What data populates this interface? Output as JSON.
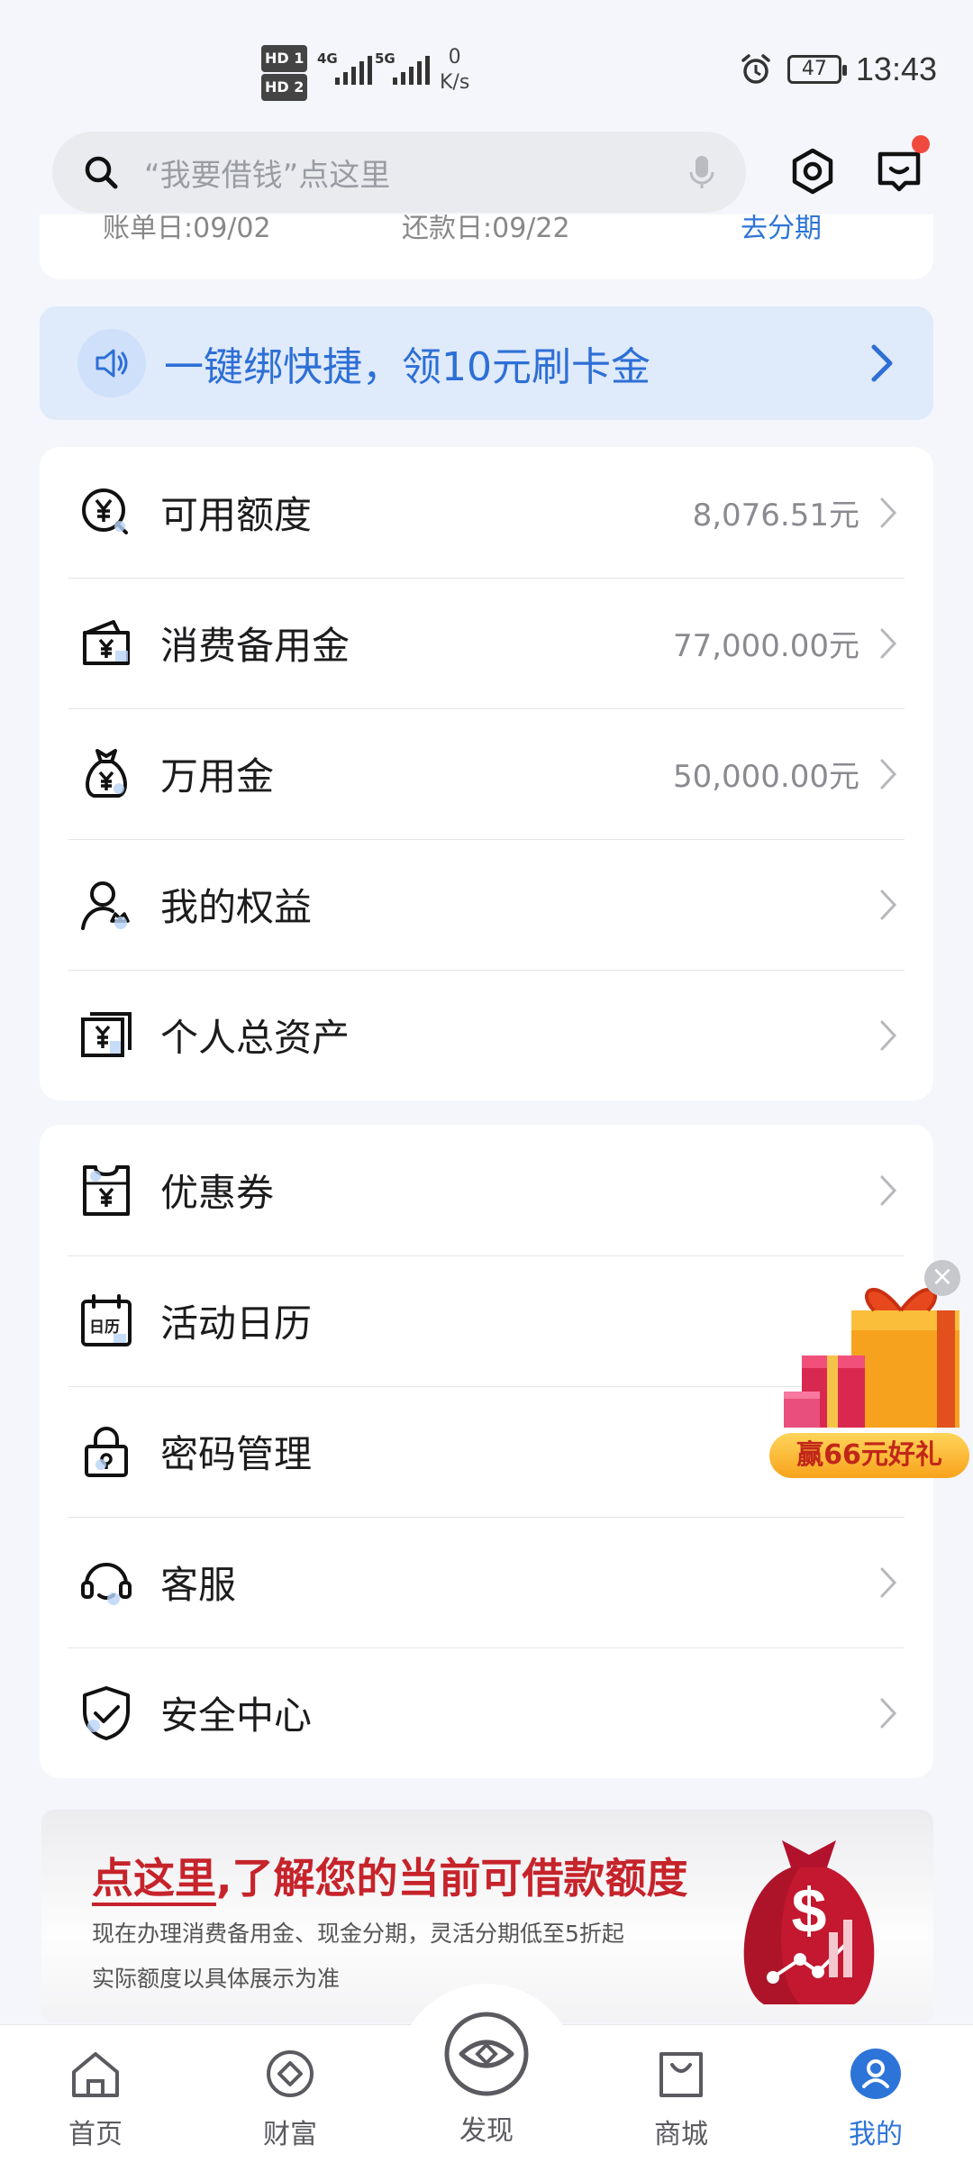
{
  "status_bar": {
    "sim1": "HD 1",
    "sim2": "HD 2",
    "net1": "4G",
    "net2": "5G",
    "speed_value": "0",
    "speed_unit": "K/s",
    "battery": "47",
    "time": "13:43"
  },
  "header": {
    "search_placeholder": "“我要借钱”点这里",
    "icons": [
      "search-icon",
      "mic-icon",
      "settings-icon",
      "message-icon"
    ]
  },
  "bill_card": {
    "statement_date": "账单日:09/02",
    "repayment_date": "还款日:09/22",
    "installment_link": "去分期"
  },
  "banner": {
    "text": "一键绑快捷，领10元刷卡金"
  },
  "account_list": [
    {
      "label": "可用额度",
      "value": "8,076.51元",
      "icon": "yuan-search-icon"
    },
    {
      "label": "消费备用金",
      "value": "77,000.00元",
      "icon": "yuan-wallet-icon"
    },
    {
      "label": "万用金",
      "value": "50,000.00元",
      "icon": "money-bag-icon"
    },
    {
      "label": "我的权益",
      "value": "",
      "icon": "user-crown-icon"
    },
    {
      "label": "个人总资产",
      "value": "",
      "icon": "yuan-card-icon"
    }
  ],
  "service_list": [
    {
      "label": "优惠券",
      "icon": "coupon-icon"
    },
    {
      "label": "活动日历",
      "icon": "calendar-icon",
      "icon_text": "日历"
    },
    {
      "label": "密码管理",
      "icon": "lock-icon"
    },
    {
      "label": "客服",
      "icon": "headset-icon"
    },
    {
      "label": "安全中心",
      "icon": "shield-check-icon"
    }
  ],
  "floating_gift": {
    "label": "赢66元好礼"
  },
  "promo": {
    "title_part1": "点这里",
    "title_part2": ",了解您的当前可借款额度",
    "line1": "现在办理消费备用金、现金分期，灵活分期低至5折起",
    "line2": "实际额度以具体展示为准"
  },
  "tabbar": {
    "items": [
      {
        "label": "首页",
        "icon": "home-icon"
      },
      {
        "label": "财富",
        "icon": "wealth-icon"
      },
      {
        "label": "发现",
        "icon": "eye-icon"
      },
      {
        "label": "商城",
        "icon": "shopping-bag-icon"
      },
      {
        "label": "我的",
        "icon": "profile-icon",
        "active": true
      }
    ]
  },
  "colors": {
    "accent": "#2d74d8",
    "promo_red": "#c6232b",
    "badge": "#f04a3e"
  }
}
